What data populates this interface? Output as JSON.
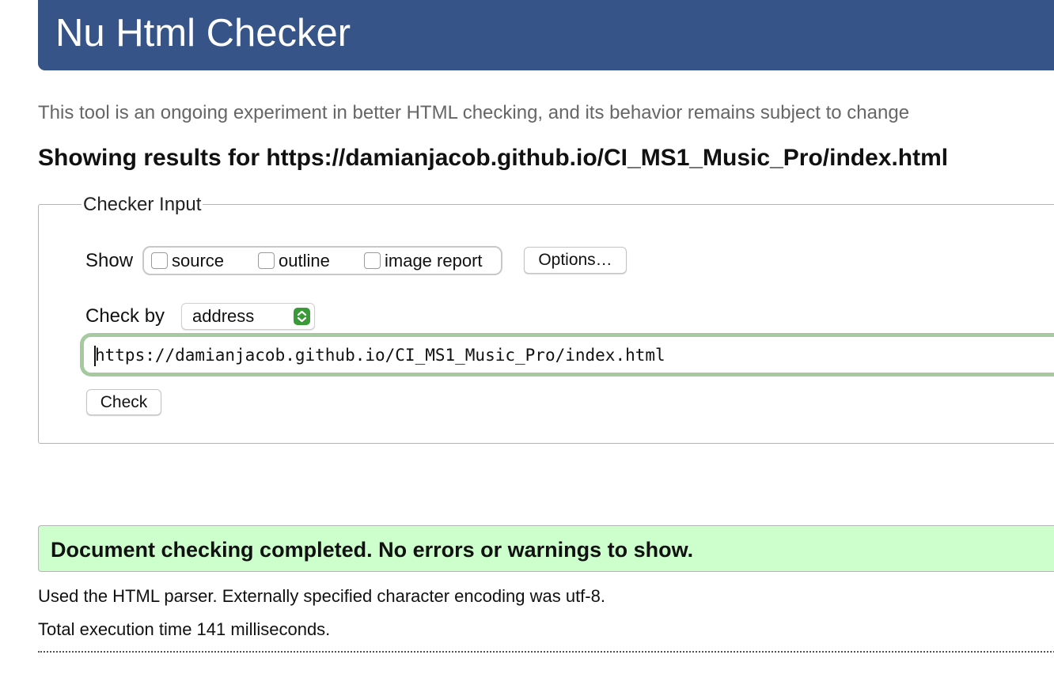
{
  "header": {
    "title": "Nu Html Checker",
    "color": "#365487"
  },
  "disclaimer": "This tool is an ongoing experiment in better HTML checking, and its behavior remains subject to change",
  "results_heading": "Showing results for https://damianjacob.github.io/CI_MS1_Music_Pro/index.html",
  "checker_input": {
    "legend": "Checker Input",
    "show_label": "Show",
    "show_options": [
      {
        "label": "source",
        "checked": false
      },
      {
        "label": "outline",
        "checked": false
      },
      {
        "label": "image report",
        "checked": false
      }
    ],
    "options_button": "Options…",
    "check_by_label": "Check by",
    "check_by_value": "address",
    "url_value": "https://damianjacob.github.io/CI_MS1_Music_Pro/index.html",
    "check_button": "Check",
    "select_accent": "#3a9a38",
    "input_focus_color": "#a7c9a0"
  },
  "result": {
    "message": "Document checking completed. No errors or warnings to show.",
    "background": "#ccffcc"
  },
  "details": {
    "parser": "Used the HTML parser. Externally specified character encoding was utf-8.",
    "execution_time": "Total execution time 141 milliseconds."
  }
}
